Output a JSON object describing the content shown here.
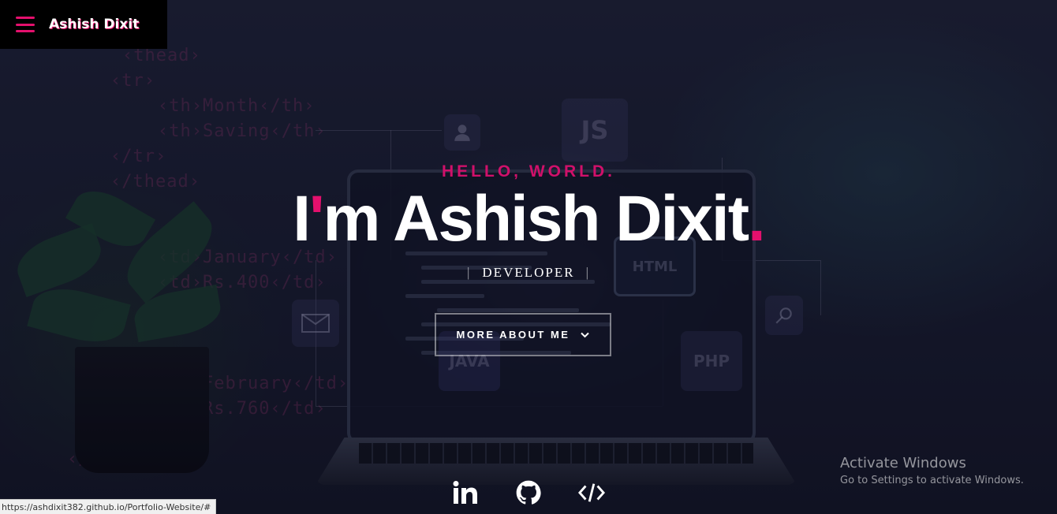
{
  "nav": {
    "menu_icon": "hamburger-menu-icon",
    "brand": "Ashish Dixit"
  },
  "hero": {
    "greeting": "HELLO, WORLD.",
    "name_prefix": "I",
    "name_apostrophe": "'",
    "name_rest": "m Ashish Dixit",
    "name_dot": ".",
    "role": "DEVELOPER",
    "pipe": "|",
    "more_button": "more about me",
    "more_icon": "chevron-down-icon"
  },
  "socials": [
    {
      "name": "linkedin",
      "icon": "linkedin-icon"
    },
    {
      "name": "github",
      "icon": "github-icon"
    },
    {
      "name": "code",
      "icon": "code-icon"
    }
  ],
  "windows_watermark": {
    "title": "Activate Windows",
    "subtitle": "Go to Settings to activate Windows."
  },
  "status_bar": {
    "url": "https://ashdixit382.github.io/Portfolio-Website/#"
  },
  "colors": {
    "accent": "#e4106d",
    "background": "#1b1f33",
    "text": "#ffffff"
  }
}
